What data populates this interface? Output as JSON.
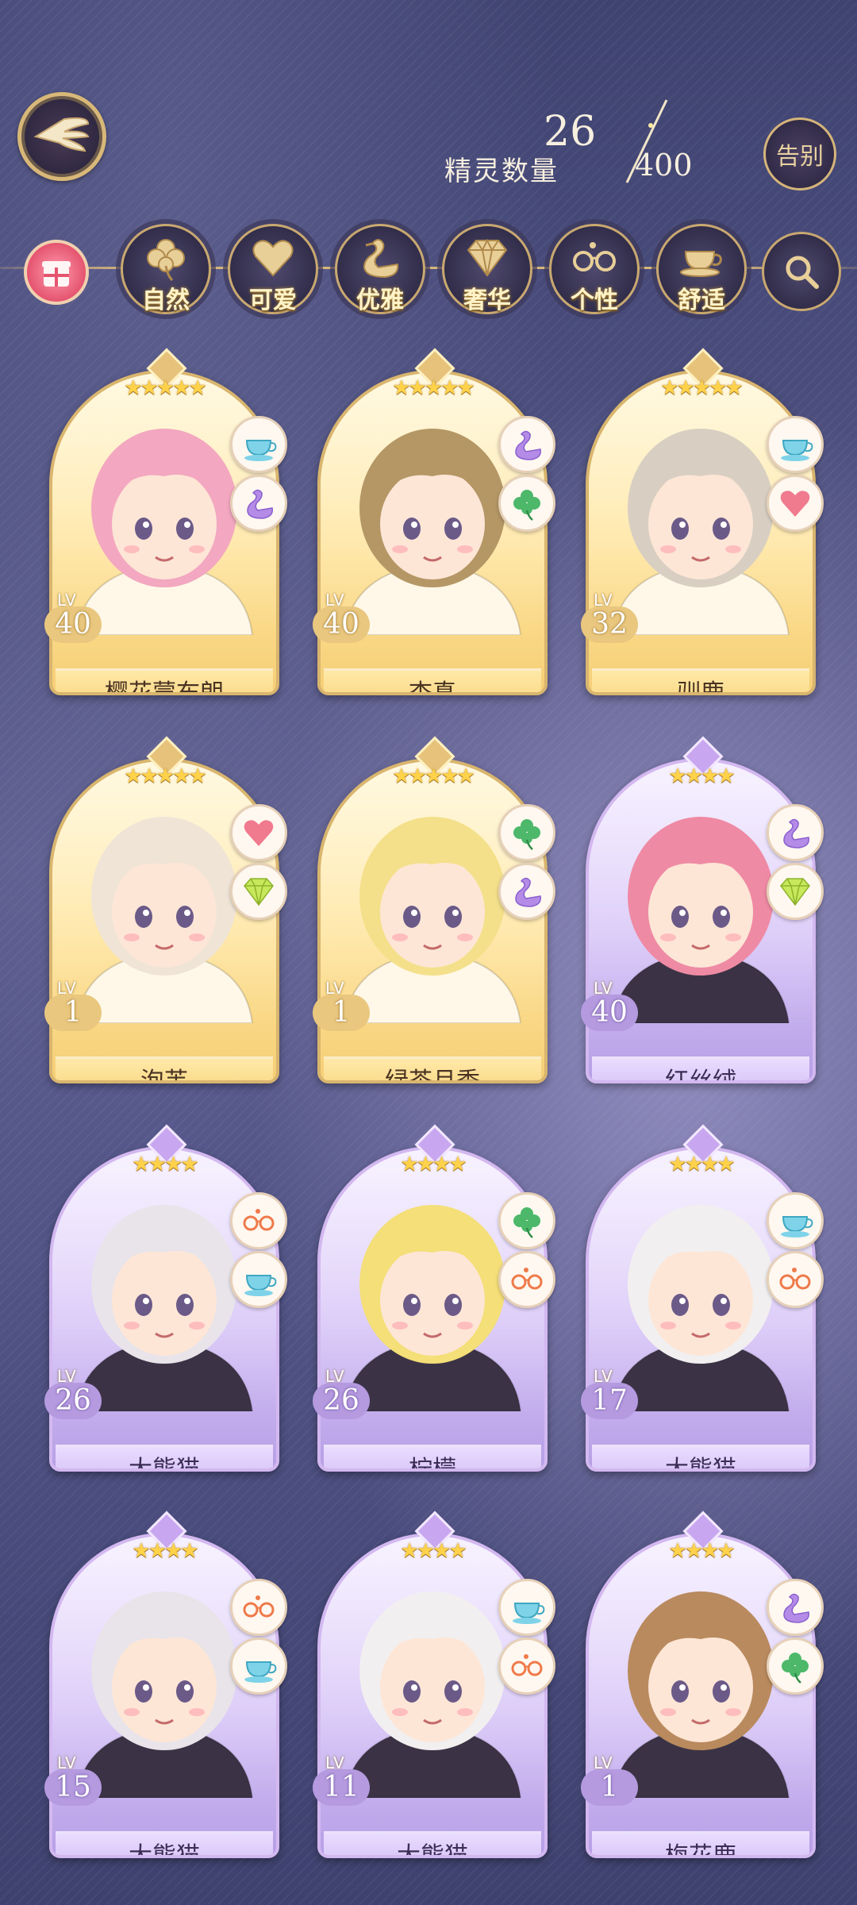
{
  "header": {
    "count_current": "26",
    "count_label": "精灵数量",
    "count_max": "400",
    "farewell_label": "告别"
  },
  "filters": [
    {
      "label": "自然",
      "icon": "clover-icon"
    },
    {
      "label": "可爱",
      "icon": "heart-icon"
    },
    {
      "label": "优雅",
      "icon": "swan-icon"
    },
    {
      "label": "奢华",
      "icon": "diamond-icon"
    },
    {
      "label": "个性",
      "icon": "glasses-icon"
    },
    {
      "label": "舒适",
      "icon": "teacup-icon"
    }
  ],
  "cards": [
    {
      "name": "樱花蒙布朗",
      "level": "40",
      "stars": 5,
      "frame": "gold",
      "tags": [
        "teacup-icon",
        "swan-icon"
      ],
      "hair": "#f3a7c0"
    },
    {
      "name": "杏真",
      "level": "40",
      "stars": 5,
      "frame": "gold",
      "tags": [
        "swan-icon",
        "clover-icon"
      ],
      "hair": "#b59766"
    },
    {
      "name": "驯鹿",
      "level": "32",
      "stars": 5,
      "frame": "gold",
      "tags": [
        "teacup-icon",
        "heart-icon"
      ],
      "hair": "#d8cfc2"
    },
    {
      "name": "泡芙",
      "level": "1",
      "stars": 5,
      "frame": "gold",
      "tags": [
        "heart-icon",
        "diamond-icon"
      ],
      "hair": "#efe4d6"
    },
    {
      "name": "绿茶月季",
      "level": "1",
      "stars": 5,
      "frame": "gold",
      "tags": [
        "clover-icon",
        "swan-icon"
      ],
      "hair": "#f4e08a"
    },
    {
      "name": "红丝绒",
      "level": "40",
      "stars": 4,
      "frame": "purple",
      "tags": [
        "swan-icon",
        "diamond-icon"
      ],
      "hair": "#ef8aa4"
    },
    {
      "name": "大熊猫",
      "level": "26",
      "stars": 4,
      "frame": "purple",
      "tags": [
        "glasses-icon",
        "teacup-icon"
      ],
      "hair": "#e8e4ea"
    },
    {
      "name": "柠檬",
      "level": "26",
      "stars": 4,
      "frame": "purple",
      "tags": [
        "clover-icon",
        "glasses-icon"
      ],
      "hair": "#f4df78"
    },
    {
      "name": "大熊猫",
      "level": "17",
      "stars": 4,
      "frame": "purple",
      "tags": [
        "teacup-icon",
        "glasses-icon"
      ],
      "hair": "#f2eff0"
    },
    {
      "name": "大熊猫",
      "level": "15",
      "stars": 4,
      "frame": "purple",
      "tags": [
        "glasses-icon",
        "teacup-icon"
      ],
      "hair": "#e8e4ea"
    },
    {
      "name": "大熊猫",
      "level": "11",
      "stars": 4,
      "frame": "purple",
      "tags": [
        "teacup-icon",
        "glasses-icon"
      ],
      "hair": "#f2eff0"
    },
    {
      "name": "梅花鹿",
      "level": "1",
      "stars": 4,
      "frame": "purple",
      "tags": [
        "swan-icon",
        "clover-icon"
      ],
      "hair": "#b98a5e"
    }
  ],
  "colors": {
    "gold_frame": "#d9b56e",
    "purple_frame": "#d3b8f0",
    "star": "#ffd24a"
  }
}
